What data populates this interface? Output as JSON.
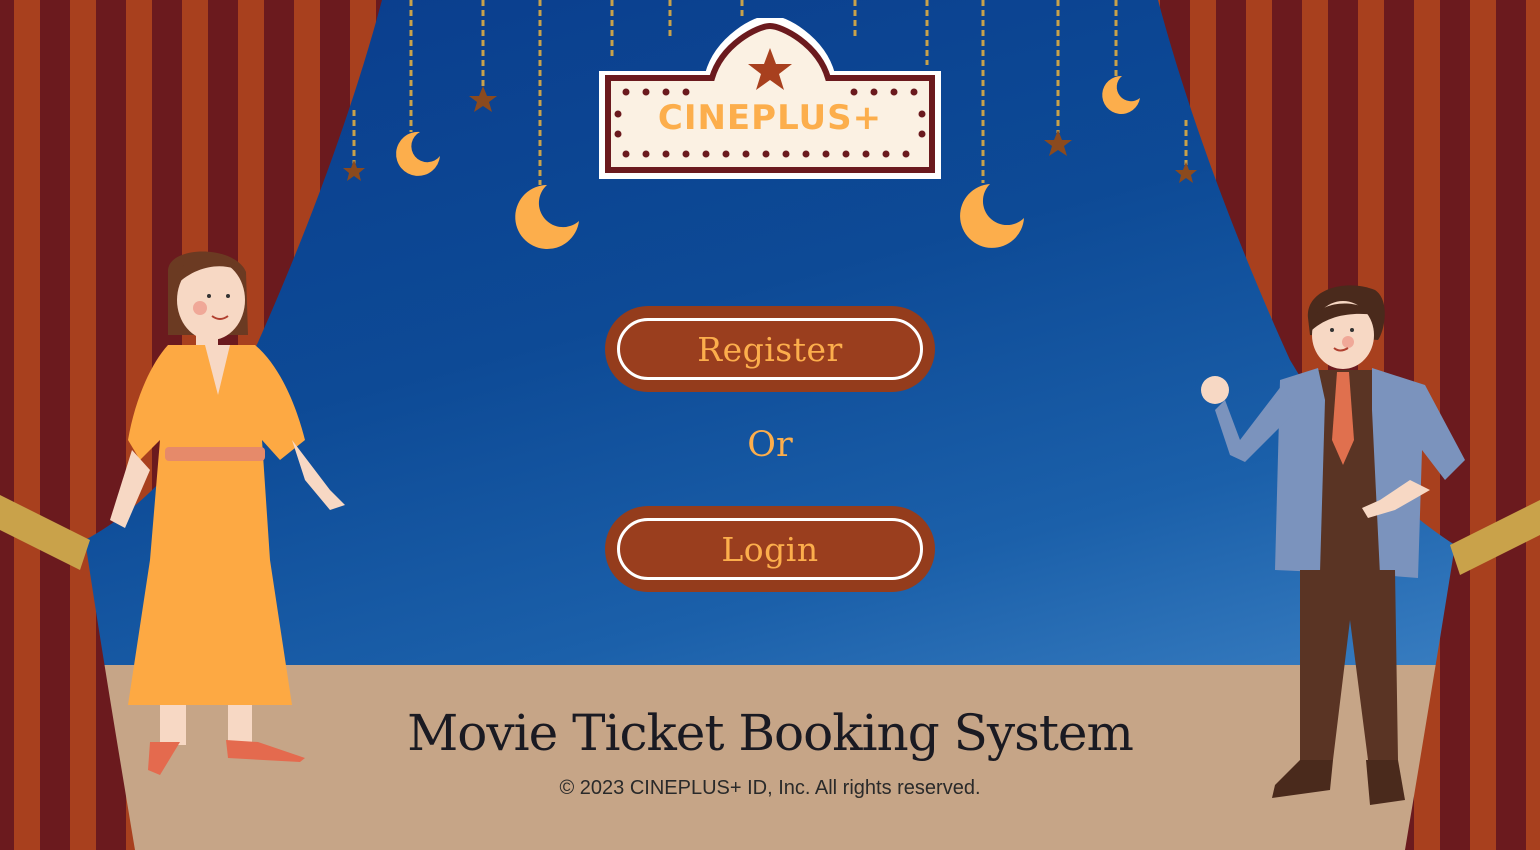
{
  "logo": {
    "text": "CINEPLUS+"
  },
  "actions": {
    "register_label": "Register",
    "or_label": "Or",
    "login_label": "Login"
  },
  "footer": {
    "title": "Movie Ticket Booking System",
    "copyright": "© 2023 CINEPLUS+ ID, Inc. All rights reserved."
  },
  "colors": {
    "backdrop": "#0d4a96",
    "floor": "#c6a587",
    "button": "#943c1c",
    "accent": "#fcae4c",
    "curtain_dark": "#6b1a1e",
    "curtain_light": "#a8401e"
  },
  "icons": [
    "star-icon",
    "crescent-moon-icon",
    "curtain",
    "woman-illustration",
    "man-illustration",
    "marquee-sign"
  ]
}
